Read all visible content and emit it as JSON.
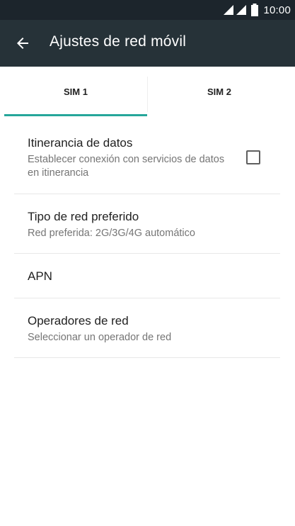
{
  "status_bar": {
    "time": "10:00",
    "icons": [
      "signal-icon",
      "signal-icon",
      "battery-icon"
    ]
  },
  "app_bar": {
    "back_icon": "arrow-left-icon",
    "title": "Ajustes de red móvil"
  },
  "tabs": [
    {
      "label": "SIM 1",
      "selected": true
    },
    {
      "label": "SIM 2",
      "selected": false
    }
  ],
  "accent_color": "#26a69a",
  "settings": {
    "roaming": {
      "title": "Itinerancia de datos",
      "summary": "Establecer conexión con servicios de datos en itinerancia",
      "checked": false
    },
    "network_type": {
      "title": "Tipo de red preferido",
      "summary": "Red preferida: 2G/3G/4G automático"
    },
    "apn": {
      "title": "APN"
    },
    "operators": {
      "title": "Operadores de red",
      "summary": "Seleccionar un operador de red"
    }
  }
}
